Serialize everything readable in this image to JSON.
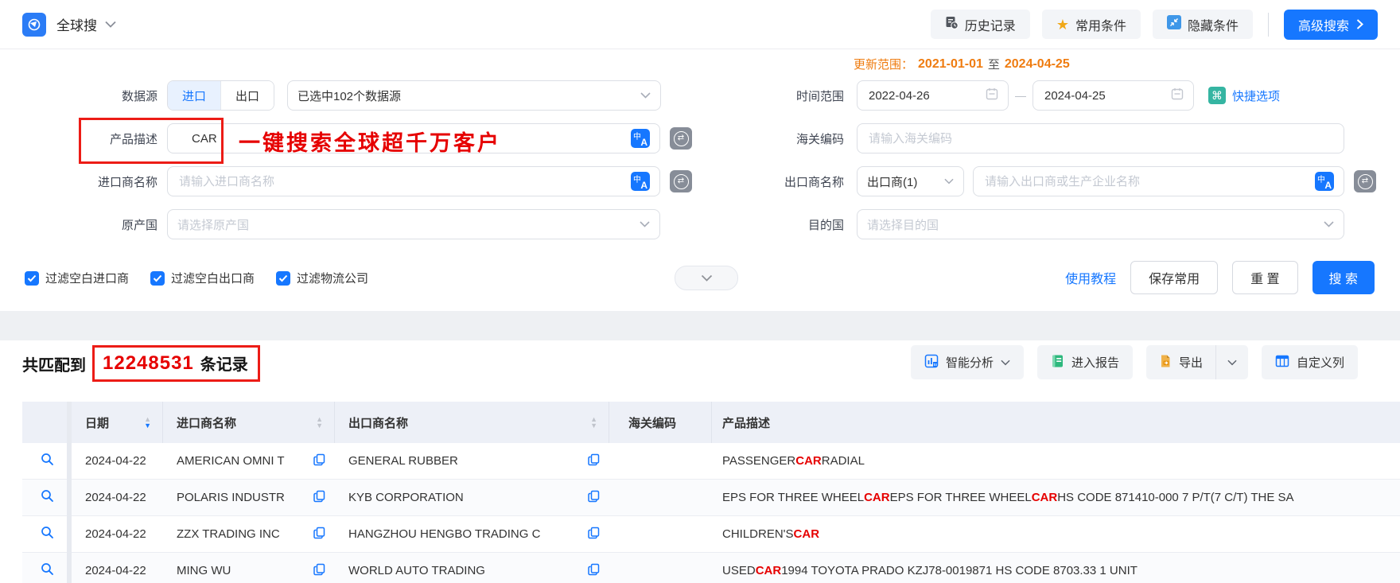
{
  "topbar": {
    "app_title": "全球搜",
    "buttons": {
      "history": "历史记录",
      "favorites": "常用条件",
      "hide": "隐藏条件",
      "advanced": "高级搜索"
    }
  },
  "form": {
    "update_range": {
      "label": "更新范围：",
      "start_date": "2021-01-01",
      "to": "至",
      "end_date": "2024-04-25"
    },
    "rows": {
      "data_source": {
        "label": "数据源",
        "import_tab": "进口",
        "export_tab": "出口",
        "selected": "已选中102个数据源"
      },
      "product_desc": {
        "label": "产品描述",
        "value": "CAR",
        "annotation": "一键搜索全球超千万客户"
      },
      "importer": {
        "label": "进口商名称",
        "placeholder": "请输入进口商名称"
      },
      "origin_country": {
        "label": "原产国",
        "placeholder": "请选择原产国"
      },
      "time_range": {
        "label": "时间范围",
        "start": "2022-04-26",
        "separator": "—",
        "end": "2024-04-25",
        "quick_options": "快捷选项"
      },
      "hs_code": {
        "label": "海关编码",
        "placeholder": "请输入海关编码"
      },
      "exporter": {
        "label": "出口商名称",
        "type_selected": "出口商(1)",
        "placeholder": "请输入出口商或生产企业名称"
      },
      "destination": {
        "label": "目的国",
        "placeholder": "请选择目的国"
      }
    },
    "checkboxes": [
      {
        "label": "过滤空白进口商",
        "checked": true
      },
      {
        "label": "过滤空白出口商",
        "checked": true
      },
      {
        "label": "过滤物流公司",
        "checked": true
      }
    ],
    "actions": {
      "tutorial": "使用教程",
      "save": "保存常用",
      "reset": "重 置",
      "search": "搜 索"
    }
  },
  "results": {
    "prefix": "共匹配到",
    "count": "12248531",
    "suffix": "条记录",
    "buttons": {
      "analysis": "智能分析",
      "report": "进入报告",
      "export": "导出",
      "custom_columns": "自定义列"
    }
  },
  "table": {
    "columns": [
      "日期",
      "进口商名称",
      "出口商名称",
      "海关编码",
      "产品描述"
    ],
    "rows": [
      {
        "date": "2024-04-22",
        "importer": "AMERICAN OMNI T",
        "exporter": "GENERAL RUBBER",
        "hs_code": "",
        "product": [
          {
            "t": "PASSENGER ",
            "hl": false
          },
          {
            "t": "CAR",
            "hl": true
          },
          {
            "t": " RADIAL",
            "hl": false
          }
        ]
      },
      {
        "date": "2024-04-22",
        "importer": "POLARIS INDUSTR",
        "exporter": "KYB CORPORATION",
        "hs_code": "",
        "product": [
          {
            "t": "EPS FOR THREE WHEEL ",
            "hl": false
          },
          {
            "t": "CAR",
            "hl": true
          },
          {
            "t": " EPS FOR THREE WHEEL ",
            "hl": false
          },
          {
            "t": "CAR",
            "hl": true
          },
          {
            "t": " HS CODE 871410-000 7 P/T(7 C/T) THE SA",
            "hl": false
          }
        ]
      },
      {
        "date": "2024-04-22",
        "importer": "ZZX TRADING INC",
        "exporter": "HANGZHOU HENGBO TRADING C",
        "hs_code": "",
        "product": [
          {
            "t": "CHILDREN'S ",
            "hl": false
          },
          {
            "t": "CAR",
            "hl": true
          }
        ]
      },
      {
        "date": "2024-04-22",
        "importer": "MING WU",
        "exporter": "WORLD AUTO TRADING",
        "hs_code": "",
        "product": [
          {
            "t": "USED ",
            "hl": false
          },
          {
            "t": "CAR",
            "hl": true
          },
          {
            "t": " 1994 TOYOTA PRADO KZJ78-0019871 HS CODE 8703.33 1 UNIT",
            "hl": false
          }
        ]
      }
    ]
  },
  "colors": {
    "accent": "#1677ff",
    "highlight_red": "#e60000",
    "orange": "#ef7c10"
  }
}
